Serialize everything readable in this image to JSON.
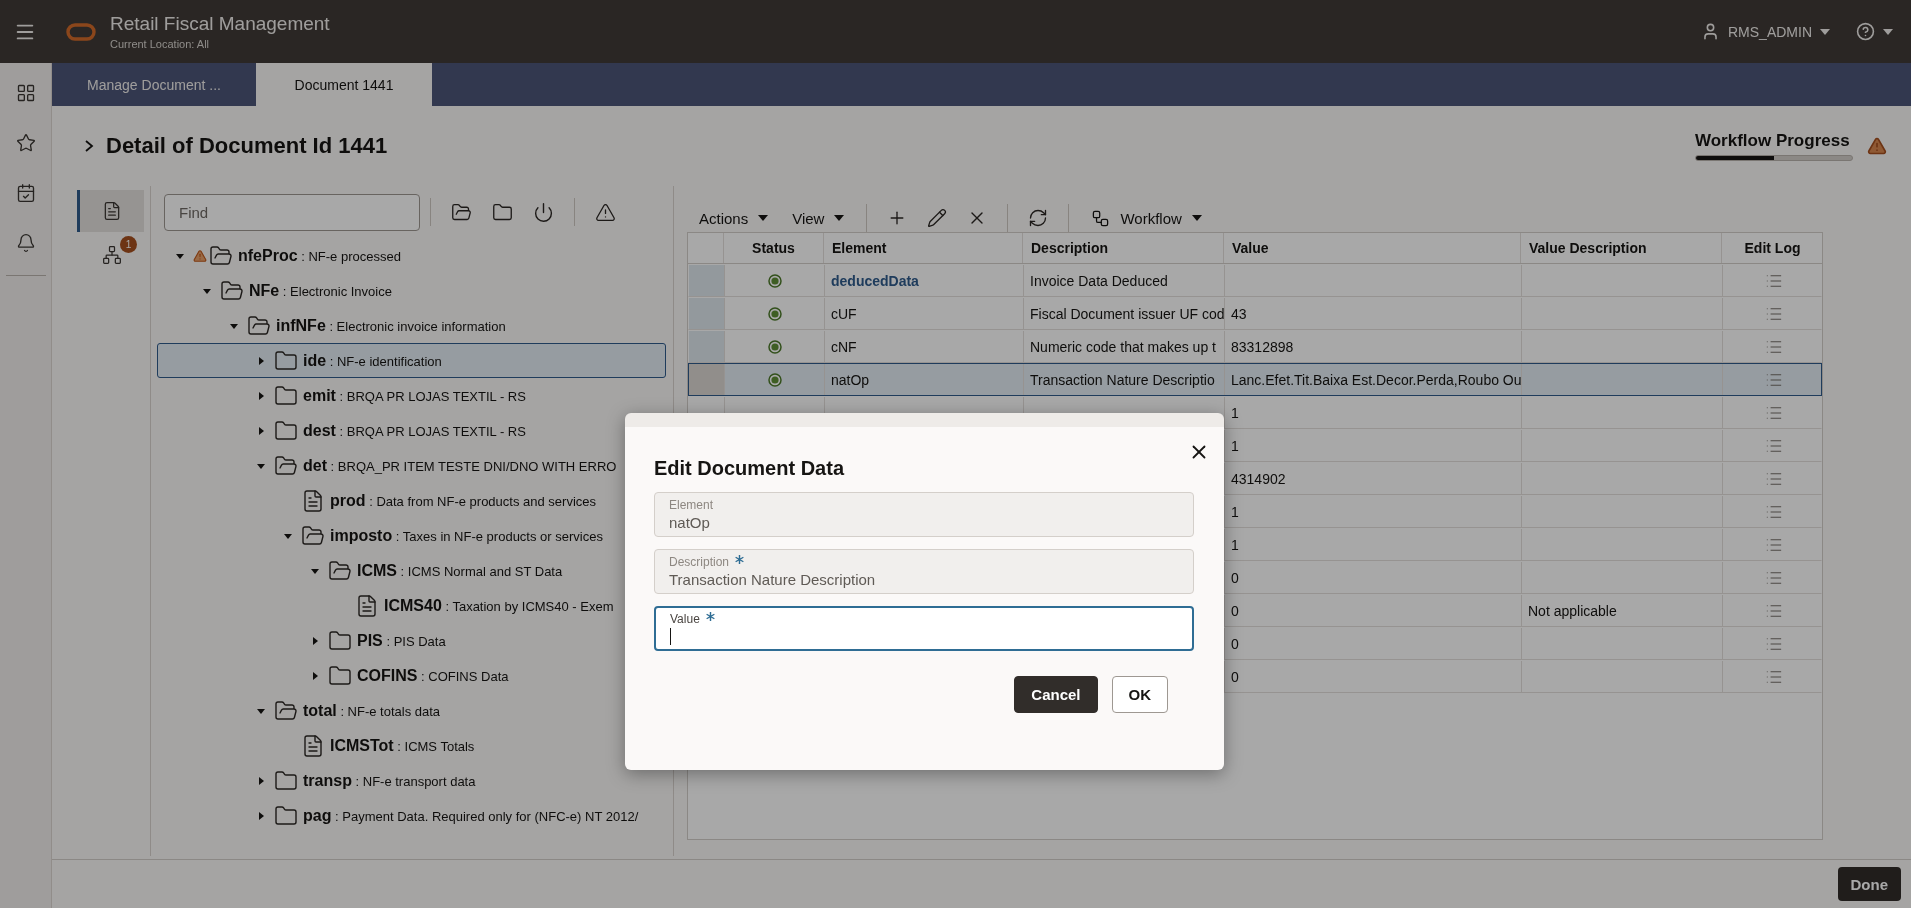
{
  "header": {
    "app_title": "Retail Fiscal Management",
    "location": "Current Location: All",
    "user": "RMS_ADMIN"
  },
  "tabs": [
    {
      "label": "Manage Document ...",
      "selected": false
    },
    {
      "label": "Document 1441",
      "selected": true
    }
  ],
  "page_title": "Detail of Document Id 1441",
  "workflow_progress": {
    "label": "Workflow Progress",
    "level": 0.5,
    "warning": true
  },
  "side_tabs": [
    {
      "kind": "tree",
      "selected": true
    },
    {
      "kind": "graph",
      "selected": false,
      "badge": "1"
    }
  ],
  "tree_find": {
    "placeholder": "Find"
  },
  "tree": [
    {
      "label": "**nfeProc** : NF-e processed",
      "kind": "folder",
      "expanded": true,
      "warning": true,
      "selected": false,
      "children": [
        {
          "label": "**NFe** : Electronic Invoice",
          "kind": "folder",
          "expanded": true,
          "warning": false,
          "selected": false,
          "children": [
            {
              "label": "**infNFe** : Electronic invoice information",
              "kind": "folder",
              "expanded": true,
              "warning": false,
              "selected": false,
              "children": [
                {
                  "label": "**ide** : NF-e identification",
                  "kind": "folder",
                  "expanded": false,
                  "warning": false,
                  "selected": true
                },
                {
                  "label": "**emit** : BRQA PR LOJAS TEXTIL - RS",
                  "kind": "folder",
                  "expanded": false,
                  "warning": false,
                  "selected": false
                },
                {
                  "label": "**dest** : BRQA PR LOJAS TEXTIL - RS",
                  "kind": "folder",
                  "expanded": false,
                  "warning": false,
                  "selected": false
                },
                {
                  "label": "**det** : BRQA_PR ITEM TESTE DNI/DNO WITH ERRO",
                  "kind": "folder",
                  "expanded": true,
                  "warning": false,
                  "selected": false,
                  "children": [
                    {
                      "label": "**prod** : Data from NF-e products and services",
                      "kind": "document",
                      "warning": false,
                      "selected": false
                    },
                    {
                      "label": "**imposto** : Taxes in NF-e products or services",
                      "kind": "folder",
                      "expanded": true,
                      "warning": false,
                      "selected": false,
                      "children": [
                        {
                          "label": "**ICMS** : ICMS Normal and ST Data",
                          "kind": "folder",
                          "expanded": true,
                          "warning": false,
                          "selected": false,
                          "children": [
                            {
                              "label": "**ICMS40** : Taxation by ICMS40 - Exem",
                              "kind": "document",
                              "warning": false,
                              "selected": false
                            }
                          ]
                        },
                        {
                          "label": "**PIS** : PIS Data",
                          "kind": "folder",
                          "expanded": false,
                          "warning": false,
                          "selected": false
                        },
                        {
                          "label": "**COFINS** : COFINS Data",
                          "kind": "folder",
                          "expanded": false,
                          "warning": false,
                          "selected": false
                        }
                      ]
                    }
                  ]
                },
                {
                  "label": "**total** : NF-e totals data",
                  "kind": "folder",
                  "expanded": true,
                  "warning": false,
                  "selected": false,
                  "children": [
                    {
                      "label": "**ICMSTot** : ICMS Totals",
                      "kind": "document",
                      "warning": false,
                      "selected": false
                    }
                  ]
                },
                {
                  "label": "**transp** : NF-e transport data",
                  "kind": "folder",
                  "expanded": false,
                  "warning": false,
                  "selected": false
                },
                {
                  "label": "**pag** : Payment Data. Required only for (NFC-e) NT 2012/",
                  "kind": "folder",
                  "expanded": false,
                  "warning": false,
                  "selected": false
                }
              ]
            }
          ]
        }
      ]
    }
  ],
  "table_toolbar": [
    {
      "kind": "menu",
      "label": "Actions"
    },
    {
      "kind": "menu",
      "label": "View"
    },
    {
      "kind": "separator"
    },
    {
      "kind": "add"
    },
    {
      "kind": "edit"
    },
    {
      "kind": "delete"
    },
    {
      "kind": "separator"
    },
    {
      "kind": "refresh"
    },
    {
      "kind": "separator"
    },
    {
      "kind": "workflow",
      "label": "Workflow"
    }
  ],
  "table": {
    "columns": [
      "Status",
      "Element",
      "Description",
      "Value",
      "Value Description",
      "Edit Log"
    ],
    "rows": [
      {
        "selected": false,
        "valid": true,
        "element": "deducedData",
        "link": true,
        "description": "Invoice Data Deduced"
      },
      {
        "selected": false,
        "valid": true,
        "element": "cUF",
        "link": false,
        "description": "Fiscal Document issuer UF cod",
        "value": "43"
      },
      {
        "selected": false,
        "valid": true,
        "element": "cNF",
        "link": false,
        "description": "Numeric code that makes up t",
        "value": "83312898"
      },
      {
        "selected": true,
        "valid": true,
        "element": "natOp",
        "link": false,
        "description": "Transaction Nature Descriptio",
        "value": "Lanc.Efet.Tit.Baixa Est.Decor.Perda,Roubo Ou"
      },
      {
        "selected": false,
        "value": "1"
      },
      {
        "selected": false,
        "value": "1"
      },
      {
        "selected": false,
        "value": "4314902"
      },
      {
        "selected": false,
        "value": "1"
      },
      {
        "selected": false,
        "value": "1"
      },
      {
        "selected": false,
        "value": "0"
      },
      {
        "selected": false,
        "value": "0",
        "value_description": "Not applicable"
      },
      {
        "selected": false,
        "value": "0"
      },
      {
        "selected": false,
        "value": "0"
      }
    ]
  },
  "dialog": {
    "title": "Edit Document Data",
    "fields": [
      {
        "label": "Element",
        "value": "natOp",
        "required": false,
        "readonly": true,
        "focused": false
      },
      {
        "label": "Description",
        "value": "Transaction Nature Description",
        "required": true,
        "readonly": true,
        "focused": false
      },
      {
        "label": "Value",
        "required": true,
        "readonly": false,
        "focused": true
      }
    ],
    "buttons": [
      {
        "label": "Cancel",
        "kind": "primary"
      },
      {
        "label": "OK",
        "kind": "secondary"
      }
    ]
  },
  "footer": {
    "button": "Done"
  }
}
